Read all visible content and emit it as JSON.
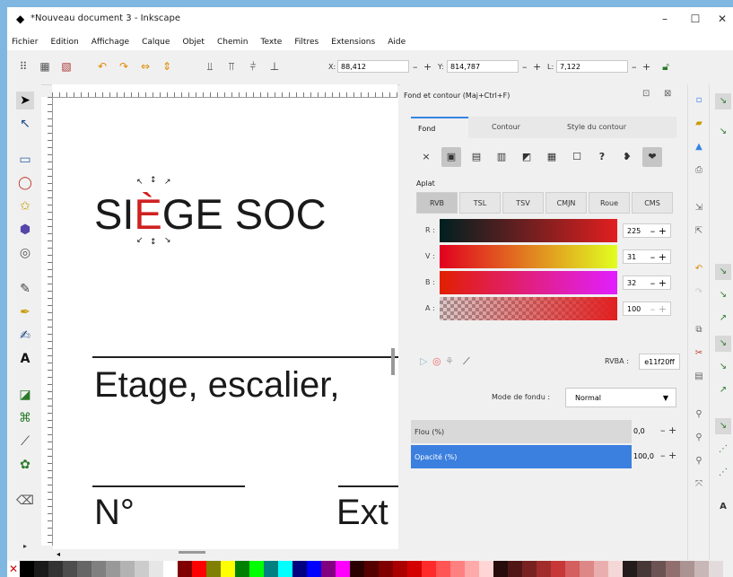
{
  "window": {
    "title": "*Nouveau document 3 - Inkscape",
    "minimize": "–",
    "maximize": "☐",
    "close": "✕"
  },
  "menu": [
    "Fichier",
    "Edition",
    "Affichage",
    "Calque",
    "Objet",
    "Chemin",
    "Texte",
    "Filtres",
    "Extensions",
    "Aide"
  ],
  "toolbar": {
    "x_label": "X:",
    "x_value": "88,412",
    "y_label": "Y:",
    "y_value": "814,787",
    "w_label": "L:",
    "w_value": "7,122",
    "minus": "–",
    "plus": "+"
  },
  "canvas": {
    "text1_pre": "SI",
    "text1_sel": "È",
    "text1_post": "GE SOC",
    "text2": "Etage, escalier,",
    "text3": "N°",
    "text4": "Ext"
  },
  "dock": {
    "title": "Fond et contour (Maj+Ctrl+F)",
    "tabs": [
      "Fond",
      "Contour",
      "Style du contour"
    ],
    "fill_icons": [
      "×",
      "▣",
      "▤",
      "▥",
      "◩",
      "▦",
      "☐",
      "?",
      "❥",
      "❤"
    ],
    "aplat_label": "Aplat",
    "modes": [
      "RVB",
      "TSL",
      "TSV",
      "CMJN",
      "Roue",
      "CMS"
    ],
    "channels": [
      {
        "label": "R :",
        "value": "225",
        "gradient_from": "#001f20",
        "gradient_to": "#e11f20"
      },
      {
        "label": "V :",
        "value": "31",
        "gradient_from": "#e10020",
        "gradient_to": "#e1ff20"
      },
      {
        "label": "B :",
        "value": "32",
        "gradient_from": "#e11f00",
        "gradient_to": "#e11fff"
      },
      {
        "label": "A :",
        "value": "100",
        "gradient_from": "#cccccc",
        "gradient_to": "#e11f20"
      }
    ],
    "rgba_label": "RVBA :",
    "rgba_value": "e11f20ff",
    "blend_label": "Mode de fondu :",
    "blend_value": "Normal",
    "blur_label": "Flou (%)",
    "blur_value": "0,0",
    "opacity_label": "Opacité (%)",
    "opacity_value": "100,0",
    "opacity_fraction": 1.0,
    "blur_fraction": 0.0
  },
  "colors": {
    "accent": "#3584e4",
    "fill": "#e11f20"
  },
  "palette": [
    "#000000",
    "#1a1a1a",
    "#333333",
    "#4d4d4d",
    "#666666",
    "#808080",
    "#999999",
    "#b3b3b3",
    "#cccccc",
    "#e6e6e6",
    "#ffffff",
    "#800000",
    "#ff0000",
    "#808000",
    "#ffff00",
    "#008000",
    "#00ff00",
    "#008080",
    "#00ffff",
    "#000080",
    "#0000ff",
    "#800080",
    "#ff00ff",
    "#2b0000",
    "#550000",
    "#800000",
    "#aa0000",
    "#d40000",
    "#ff2a2a",
    "#ff5555",
    "#ff8080",
    "#ffaaaa",
    "#ffd5d5",
    "#280b0b",
    "#501616",
    "#782121",
    "#a02c2c",
    "#c83737",
    "#d35f5f",
    "#de8787",
    "#e9afaf",
    "#f4d7d7",
    "#241c1c",
    "#483737",
    "#6c5353",
    "#916f6f",
    "#ac9393",
    "#c8b7b7",
    "#e3dbdb"
  ]
}
